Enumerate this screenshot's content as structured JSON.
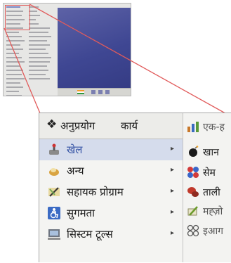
{
  "menubar": {
    "applications_label": "अनुप्रयोग",
    "actions_label": "कार्य"
  },
  "main_menu": {
    "items": [
      {
        "label": "खेल",
        "icon": "games-icon",
        "active": true
      },
      {
        "label": "अन्य",
        "icon": "other-icon"
      },
      {
        "label": "सहायक प्रोग्राम",
        "icon": "accessories-icon"
      },
      {
        "label": "सुगमता",
        "icon": "accessibility-icon"
      },
      {
        "label": "सिस्टम टूल्स",
        "icon": "system-tools-icon"
      }
    ],
    "submenu_arrow": "▸"
  },
  "sub_menu": {
    "items": [
      {
        "label": "एक-ह",
        "icon": "bars-icon"
      },
      {
        "label": "खान",
        "icon": "mine-icon"
      },
      {
        "label": "सेम",
        "icon": "balls-icon"
      },
      {
        "label": "ताली",
        "icon": "dice-icon"
      },
      {
        "label": "मह्ज़ो",
        "icon": "tiles-icon"
      },
      {
        "label": "इआग",
        "icon": "rings-icon"
      }
    ]
  },
  "colors": {
    "selection": "#d5dcec",
    "accent_text": "#3654a5",
    "zoom_line": "#e15b5b"
  }
}
